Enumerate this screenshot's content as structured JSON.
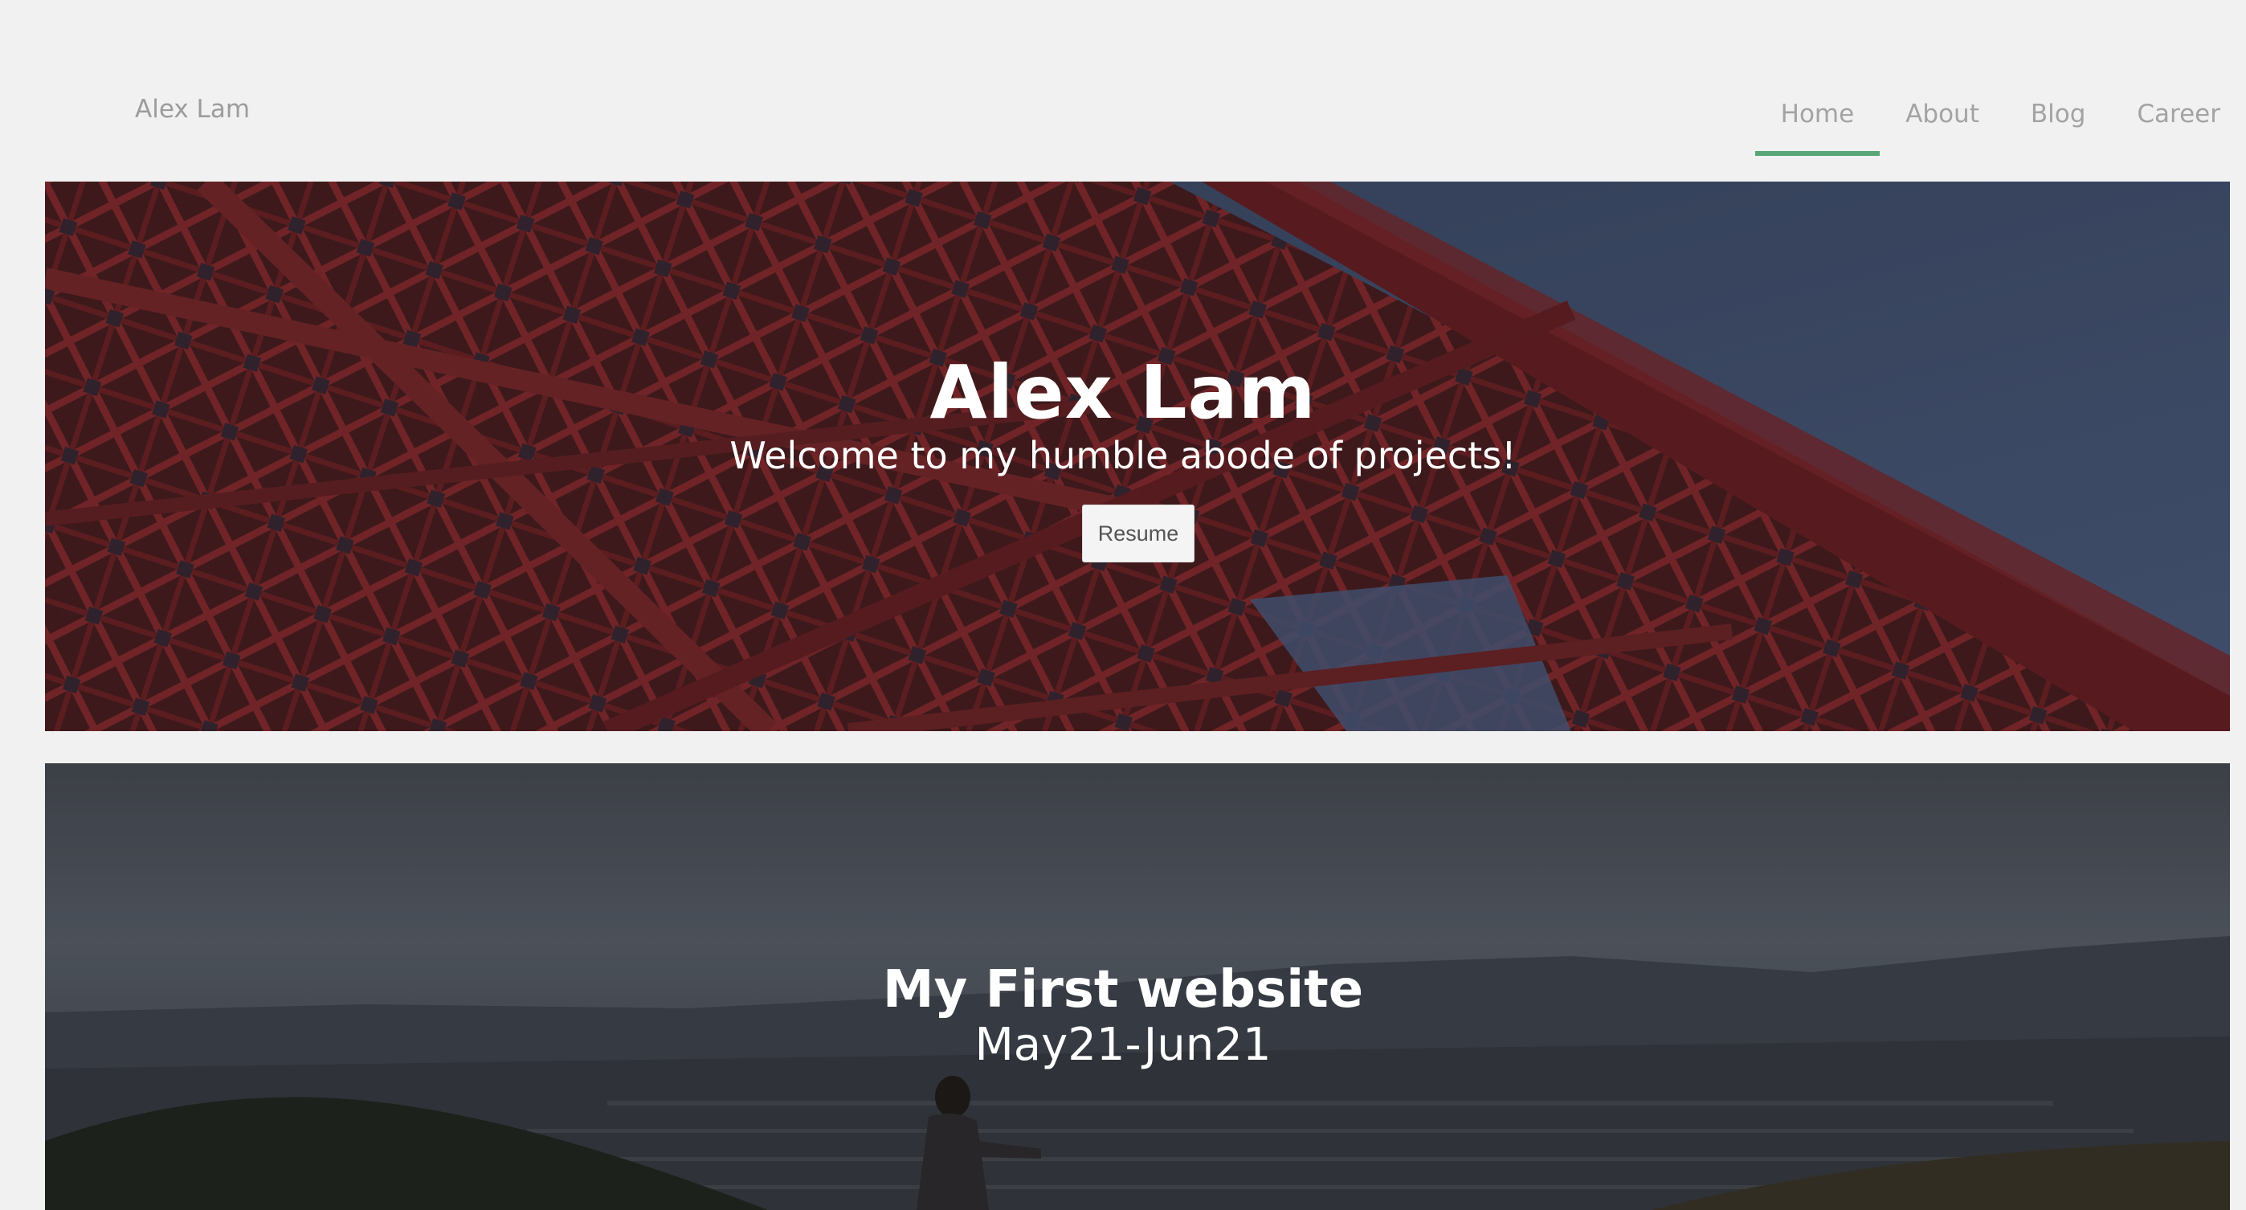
{
  "nav": {
    "brand": "Alex Lam",
    "links": [
      {
        "label": "Home",
        "active": true
      },
      {
        "label": "About",
        "active": false
      },
      {
        "label": "Blog",
        "active": false
      },
      {
        "label": "Career",
        "active": false
      }
    ],
    "accent_color": "#5aa677"
  },
  "hero": {
    "title": "Alex Lam",
    "subtitle": "Welcome to my humble abode of projects!",
    "button_label": "Resume"
  },
  "projects": [
    {
      "title": "My First website",
      "date": "May21-Jun21"
    }
  ]
}
